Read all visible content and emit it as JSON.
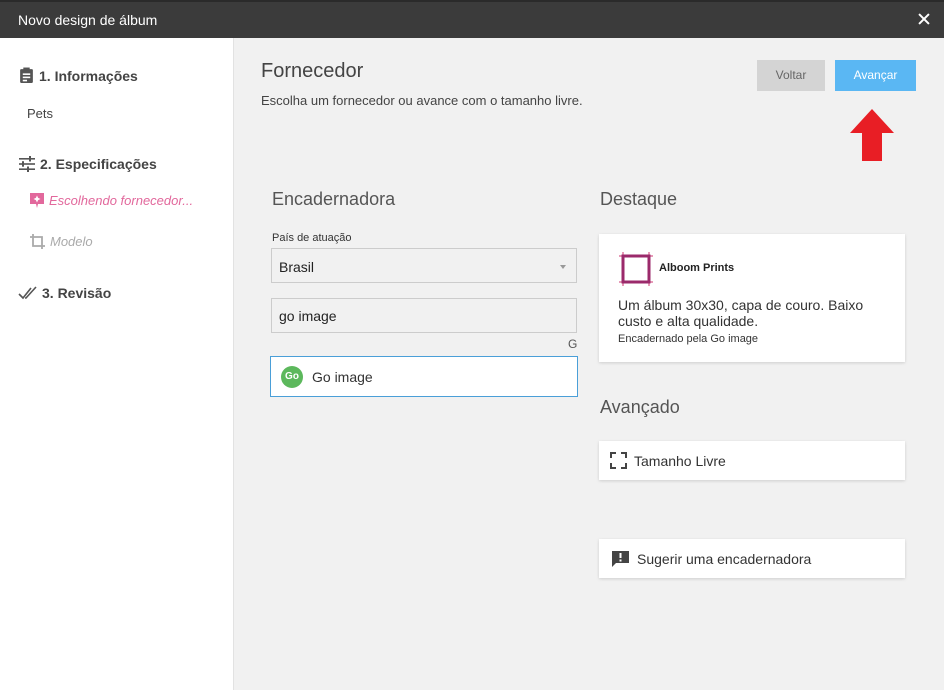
{
  "window": {
    "title": "Novo design de álbum"
  },
  "sidebar": {
    "step1": {
      "label": "1. Informações",
      "value": "Pets"
    },
    "step2": {
      "label": "2. Especificações",
      "active_sub": "Escolhendo fornecedor...",
      "sub2": "Modelo"
    },
    "step3": {
      "label": "3. Revisão"
    }
  },
  "header": {
    "title": "Fornecedor",
    "subtitle": "Escolha um fornecedor ou avance com o tamanho livre.",
    "back_label": "Voltar",
    "next_label": "Avançar"
  },
  "binder": {
    "title": "Encadernadora",
    "country_label": "País de atuação",
    "country_value": "Brasil",
    "search_value": "go image",
    "search_hint": "G",
    "result": "Go image",
    "result_logo": "Go"
  },
  "featured": {
    "title": "Destaque",
    "name": "Alboom Prints",
    "description": "Um álbum 30x30, capa de couro. Baixo custo e alta qualidade.",
    "by": "Encadernado pela Go image"
  },
  "advanced": {
    "title": "Avançado",
    "free_size": "Tamanho Livre",
    "suggest": "Sugerir uma encadernadora"
  },
  "colors": {
    "accent": "#5ab7f3",
    "active_step": "#e2689c",
    "arrow": "#e81e25",
    "go_green": "#5cb85c",
    "alboom_logo": "#9b2a6b"
  }
}
